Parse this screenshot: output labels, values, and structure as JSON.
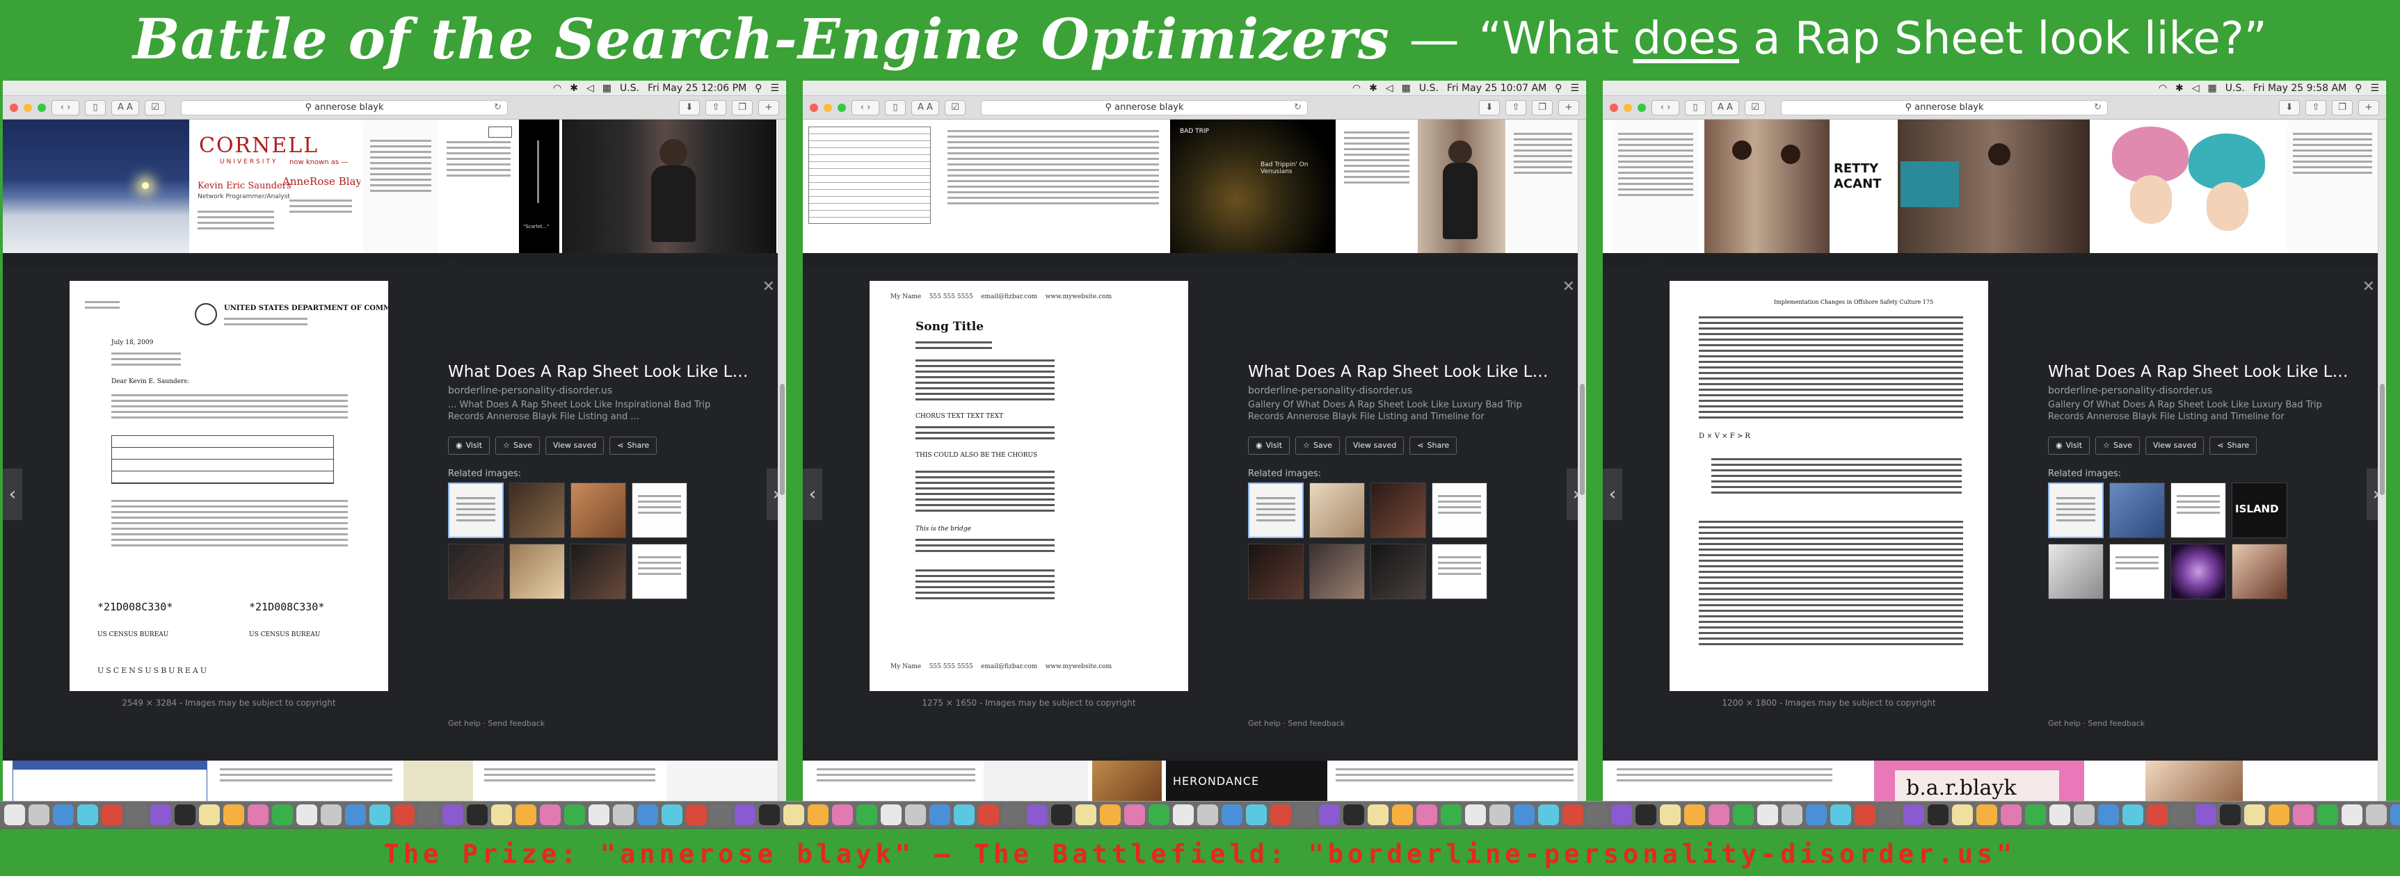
{
  "banner": {
    "title_script": "Battle of the Search-Engine Optimizers",
    "separator": "—",
    "question_open": "“What ",
    "question_emph": "does",
    "question_close": " a Rap Sheet look like?”"
  },
  "footer_text": "The Prize: \"annerose blayk\" — The Battlefield: \"borderline-personality-disorder.us\"",
  "colors": {
    "background_green": "#3aa236",
    "banner_text": "#ffffff",
    "footer_red": "#e8261f",
    "results_dark": "#222326"
  },
  "panels": [
    {
      "menubar": {
        "locale": "U.S.",
        "clock": "Fri May 25 12:06 PM"
      },
      "url": "annerose blayk",
      "detail": {
        "title": "What Does A Rap Sheet Look Like L…",
        "domain": "borderline-personality-disorder.us",
        "description": "... What Does A Rap Sheet Look Like Inspirational Bad Trip Records Annerose Blayk File Listing and ...",
        "image_size": "2549 × 3284 - Images may be subject to copyright"
      },
      "thumb_text": {
        "cornell": "CORNELL",
        "cornell_sub": "UNIVERSITY",
        "card_name": "Kevin Eric Saunders",
        "card_role": "Network Programmer/Analyst",
        "known_as_top": "now known as —",
        "known_as_name": "AnneRose Blayk",
        "poem_line": "\"Scarlet...\""
      },
      "doc_text": {
        "agency": "UNITED STATES DEPARTMENT OF COMMERCE",
        "date": "July 18, 2009",
        "salutation": "Dear Kevin E. Saunders:",
        "code_a": "*21D008C330*",
        "code_b": "*21D008C330*",
        "bureau_a": "US CENSUS BUREAU",
        "bureau_b": "US CENSUS BUREAU",
        "wordmark": "USCENSUSBUREAU"
      }
    },
    {
      "menubar": {
        "locale": "U.S.",
        "clock": "Fri May 25 10:07 AM"
      },
      "url": "annerose blayk",
      "detail": {
        "title": "What Does A Rap Sheet Look Like L…",
        "domain": "borderline-personality-disorder.us",
        "description": "Gallery Of What Does A Rap Sheet Look Like Luxury Bad Trip Records Annerose Blayk File Listing and Timeline for",
        "image_size": "1275 × 1650 - Images may be subject to copyright"
      },
      "thumb_text": {
        "album": "BAD TRIP",
        "album_sub": "Bad Trippin' On Venusians",
        "herondance": "HERONDANCE"
      },
      "doc_text": {
        "header": "My Name    555 555 5555    email@fizbar.com    www.mywebsite.com",
        "song_title": "Song Title",
        "chorus": "CHORUS TEXT TEXT TEXT",
        "coda": "THIS COULD ALSO BE THE CHORUS",
        "bridge": "This is the bridge",
        "footer": "My Name    555 555 5555    email@fizbar.com    www.mywebsite.com"
      }
    },
    {
      "menubar": {
        "locale": "U.S.",
        "clock": "Fri May 25 9:58 AM"
      },
      "url": "annerose blayk",
      "detail": {
        "title": "What Does A Rap Sheet Look Like L…",
        "domain": "borderline-personality-disorder.us",
        "description": "Gallery Of What Does A Rap Sheet Look Like Luxury Bad Trip Records Annerose Blayk File Listing and Timeline for",
        "image_size": "1200 × 1800 - Images may be subject to copyright"
      },
      "thumb_text": {
        "pretty": "RETTY",
        "vacant": "ACANT",
        "island": "ISLAND",
        "barblayk": "b.a.r.blayk"
      },
      "doc_text": {
        "running_head": "Implementation Changes in Offshore Safety Culture    175",
        "formula": "D × V × F > R"
      }
    }
  ],
  "common": {
    "visit": "Visit",
    "save": "Save",
    "view_saved": "View saved",
    "share": "Share",
    "related": "Related images:",
    "get_help": "Get help",
    "send_feedback": "Send feedback",
    "icons": [
      "close-icon",
      "chevron-left-icon",
      "chevron-right-icon",
      "globe-icon",
      "star-icon",
      "share-icon",
      "reload-icon",
      "search-icon"
    ]
  }
}
